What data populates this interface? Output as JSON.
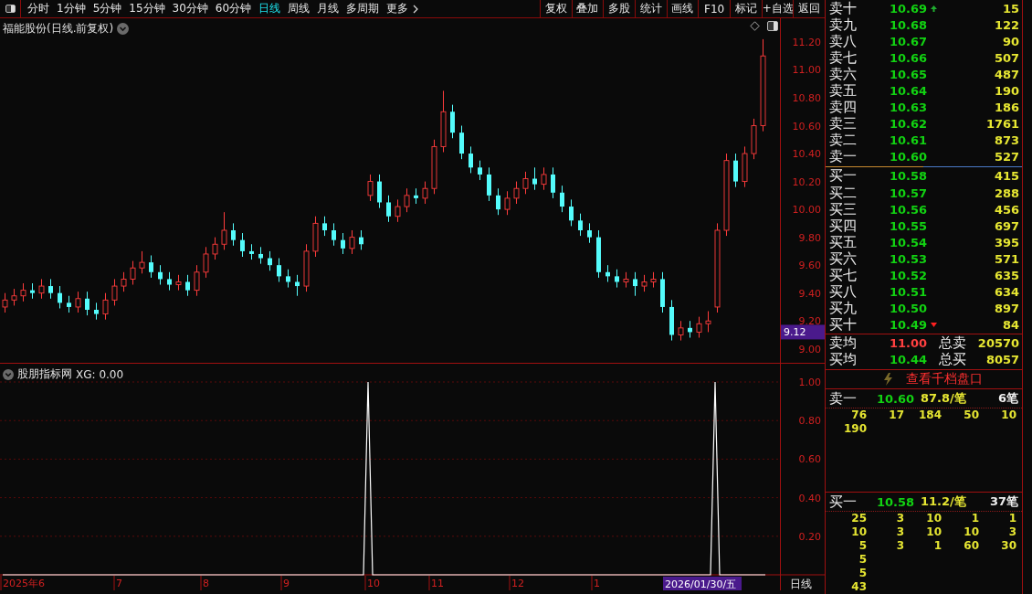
{
  "toolbar": {
    "periods": [
      {
        "label": "分时",
        "selected": false
      },
      {
        "label": "1分钟",
        "selected": false
      },
      {
        "label": "5分钟",
        "selected": false
      },
      {
        "label": "15分钟",
        "selected": false
      },
      {
        "label": "30分钟",
        "selected": false
      },
      {
        "label": "60分钟",
        "selected": false
      },
      {
        "label": "日线",
        "selected": true
      },
      {
        "label": "周线",
        "selected": false
      },
      {
        "label": "月线",
        "selected": false
      },
      {
        "label": "多周期",
        "selected": false
      },
      {
        "label": "更多",
        "selected": false
      }
    ],
    "buttons": [
      "复权",
      "叠加",
      "多股",
      "统计",
      "画线",
      "F10",
      "标记",
      "+自选",
      "返回"
    ]
  },
  "price_chart": {
    "title": "福能股份(日线.前复权)",
    "cursor_price": "9.12",
    "chart_data": {
      "type": "candlestick",
      "ylim": [
        8.9,
        11.37
      ],
      "yticks": [
        {
          "value": 11.2,
          "label": "11.20"
        },
        {
          "value": 11.0,
          "label": "11.00"
        },
        {
          "value": 10.8,
          "label": "10.80"
        },
        {
          "value": 10.6,
          "label": "10.60"
        },
        {
          "value": 10.4,
          "label": "10.40"
        },
        {
          "value": 10.2,
          "label": "10.20"
        },
        {
          "value": 10.0,
          "label": "10.00"
        },
        {
          "value": 9.8,
          "label": "9.80"
        },
        {
          "value": 9.6,
          "label": "9.60"
        },
        {
          "value": 9.4,
          "label": "9.40"
        },
        {
          "value": 9.2,
          "label": "9.20"
        },
        {
          "value": 9.0,
          "label": "9.00"
        }
      ],
      "ohlc": [
        [
          9.3,
          9.4,
          9.26,
          9.35
        ],
        [
          9.35,
          9.43,
          9.31,
          9.38
        ],
        [
          9.38,
          9.47,
          9.34,
          9.42
        ],
        [
          9.42,
          9.47,
          9.36,
          9.4
        ],
        [
          9.4,
          9.5,
          9.36,
          9.45
        ],
        [
          9.45,
          9.5,
          9.36,
          9.4
        ],
        [
          9.4,
          9.45,
          9.29,
          9.33
        ],
        [
          9.33,
          9.38,
          9.26,
          9.3
        ],
        [
          9.3,
          9.41,
          9.26,
          9.36
        ],
        [
          9.36,
          9.41,
          9.24,
          9.28
        ],
        [
          9.28,
          9.33,
          9.21,
          9.25
        ],
        [
          9.25,
          9.4,
          9.21,
          9.35
        ],
        [
          9.35,
          9.5,
          9.31,
          9.45
        ],
        [
          9.45,
          9.55,
          9.41,
          9.5
        ],
        [
          9.5,
          9.63,
          9.46,
          9.58
        ],
        [
          9.58,
          9.7,
          9.54,
          9.62
        ],
        [
          9.62,
          9.67,
          9.51,
          9.55
        ],
        [
          9.55,
          9.6,
          9.46,
          9.5
        ],
        [
          9.5,
          9.55,
          9.42,
          9.46
        ],
        [
          9.46,
          9.53,
          9.42,
          9.48
        ],
        [
          9.48,
          9.53,
          9.38,
          9.42
        ],
        [
          9.42,
          9.6,
          9.38,
          9.55
        ],
        [
          9.55,
          9.73,
          9.51,
          9.68
        ],
        [
          9.68,
          9.8,
          9.64,
          9.75
        ],
        [
          9.75,
          9.98,
          9.71,
          9.85
        ],
        [
          9.85,
          9.9,
          9.74,
          9.78
        ],
        [
          9.78,
          9.83,
          9.66,
          9.7
        ],
        [
          9.7,
          9.75,
          9.64,
          9.68
        ],
        [
          9.68,
          9.73,
          9.61,
          9.65
        ],
        [
          9.65,
          9.7,
          9.56,
          9.6
        ],
        [
          9.6,
          9.65,
          9.48,
          9.52
        ],
        [
          9.52,
          9.57,
          9.44,
          9.48
        ],
        [
          9.48,
          9.53,
          9.38,
          9.45
        ],
        [
          9.45,
          9.75,
          9.41,
          9.7
        ],
        [
          9.7,
          9.95,
          9.66,
          9.9
        ],
        [
          9.9,
          9.95,
          9.81,
          9.85
        ],
        [
          9.85,
          9.9,
          9.74,
          9.78
        ],
        [
          9.78,
          9.83,
          9.68,
          9.72
        ],
        [
          9.72,
          9.85,
          9.68,
          9.8
        ],
        [
          9.8,
          9.85,
          9.71,
          9.75
        ],
        [
          10.1,
          10.25,
          10.06,
          10.2
        ],
        [
          10.2,
          10.25,
          10.01,
          10.05
        ],
        [
          10.05,
          10.1,
          9.91,
          9.95
        ],
        [
          9.95,
          10.07,
          9.91,
          10.02
        ],
        [
          10.02,
          10.15,
          9.98,
          10.1
        ],
        [
          10.1,
          10.15,
          10.04,
          10.08
        ],
        [
          10.08,
          10.2,
          10.04,
          10.15
        ],
        [
          10.15,
          10.5,
          10.11,
          10.45
        ],
        [
          10.45,
          10.85,
          10.41,
          10.7
        ],
        [
          10.7,
          10.75,
          10.51,
          10.55
        ],
        [
          10.55,
          10.6,
          10.36,
          10.4
        ],
        [
          10.4,
          10.45,
          10.26,
          10.3
        ],
        [
          10.3,
          10.35,
          10.21,
          10.25
        ],
        [
          10.25,
          10.3,
          10.06,
          10.1
        ],
        [
          10.1,
          10.15,
          9.96,
          10.0
        ],
        [
          10.0,
          10.13,
          9.96,
          10.08
        ],
        [
          10.08,
          10.2,
          10.04,
          10.15
        ],
        [
          10.15,
          10.27,
          10.11,
          10.22
        ],
        [
          10.22,
          10.3,
          10.14,
          10.18
        ],
        [
          10.18,
          10.3,
          10.14,
          10.25
        ],
        [
          10.25,
          10.3,
          10.08,
          10.12
        ],
        [
          10.12,
          10.17,
          9.98,
          10.02
        ],
        [
          10.02,
          10.07,
          9.88,
          9.92
        ],
        [
          9.92,
          9.97,
          9.81,
          9.85
        ],
        [
          9.85,
          9.9,
          9.76,
          9.8
        ],
        [
          9.8,
          9.85,
          9.51,
          9.55
        ],
        [
          9.55,
          9.6,
          9.48,
          9.52
        ],
        [
          9.52,
          9.57,
          9.44,
          9.48
        ],
        [
          9.48,
          9.55,
          9.44,
          9.5
        ],
        [
          9.5,
          9.55,
          9.38,
          9.45
        ],
        [
          9.45,
          9.53,
          9.41,
          9.48
        ],
        [
          9.48,
          9.55,
          9.44,
          9.5
        ],
        [
          9.5,
          9.55,
          9.26,
          9.3
        ],
        [
          9.3,
          9.35,
          9.06,
          9.1
        ],
        [
          9.1,
          9.2,
          9.06,
          9.15
        ],
        [
          9.15,
          9.2,
          9.08,
          9.12
        ],
        [
          9.12,
          9.23,
          9.08,
          9.18
        ],
        [
          9.18,
          9.27,
          9.12,
          9.2
        ],
        [
          9.3,
          9.9,
          9.26,
          9.85
        ],
        [
          9.85,
          10.4,
          9.81,
          10.35
        ],
        [
          10.35,
          10.4,
          10.16,
          10.2
        ],
        [
          10.2,
          10.45,
          10.16,
          10.4
        ],
        [
          10.4,
          10.65,
          10.36,
          10.6
        ],
        [
          10.6,
          11.22,
          10.56,
          11.1
        ]
      ]
    }
  },
  "indicator": {
    "title": "股朋指标网",
    "reading": ": 0.00",
    "chart_data": {
      "type": "line",
      "ylim": [
        0,
        1
      ],
      "grid": true,
      "yticks": [
        {
          "value": 1,
          "label": "1.00"
        },
        {
          "value": 0.8,
          "label": "0.80"
        },
        {
          "value": 0.6,
          "label": "0.60"
        },
        {
          "value": 0.4,
          "label": "0.40"
        },
        {
          "value": 0.2,
          "label": "0.20"
        }
      ],
      "series": [
        {
          "name": "XG",
          "color": "#ffffff",
          "values": [
            0,
            0,
            0,
            0,
            0,
            0,
            0,
            0,
            0,
            0,
            0,
            0,
            0,
            0,
            0,
            0,
            0,
            0,
            0,
            0,
            0,
            0,
            0,
            0,
            0,
            0,
            0,
            0,
            0,
            0,
            0,
            0,
            0,
            0,
            0,
            0,
            0,
            0,
            0,
            0,
            0,
            0,
            0,
            0,
            0,
            0,
            0,
            0,
            0,
            0,
            0,
            0,
            0,
            0,
            0,
            0,
            0,
            0,
            0,
            0,
            0,
            0,
            0,
            0,
            0,
            0,
            0,
            0,
            0,
            0,
            0,
            0,
            0,
            0,
            0,
            0,
            0,
            0,
            0,
            0,
            1,
            0,
            0,
            0,
            0,
            0,
            0,
            0,
            0,
            0,
            0,
            0,
            0,
            0,
            0,
            0,
            0,
            0,
            0,
            0,
            0,
            0,
            0,
            0,
            0,
            0,
            0,
            0,
            0,
            0,
            0,
            0,
            0,
            0,
            0,
            0,
            0,
            0,
            0,
            0,
            0,
            0,
            0,
            0,
            0,
            0,
            0,
            0,
            0,
            0,
            0,
            0,
            0,
            0,
            0,
            0,
            0,
            0,
            0,
            0,
            0,
            0,
            0,
            0,
            0,
            0,
            0,
            0,
            0,
            0,
            0,
            0,
            0,
            0,
            0,
            0,
            1,
            0,
            0,
            0,
            0,
            0,
            0,
            0,
            0,
            0,
            0,
            0
          ]
        }
      ]
    }
  },
  "time_axis": {
    "labels": [
      "2025年6",
      "7",
      "8",
      "9",
      "10",
      "11",
      "12",
      "1"
    ],
    "cursor_date": "2026/01/30/五",
    "period": "日线"
  },
  "order_book": {
    "asks": [
      {
        "label": "卖十",
        "price": "10.69",
        "volume": "15",
        "kind": "up"
      },
      {
        "label": "卖九",
        "price": "10.68",
        "volume": "122",
        "kind": "plain"
      },
      {
        "label": "卖八",
        "price": "10.67",
        "volume": "90",
        "kind": "plain"
      },
      {
        "label": "卖七",
        "price": "10.66",
        "volume": "507",
        "kind": "plain"
      },
      {
        "label": "卖六",
        "price": "10.65",
        "volume": "487",
        "kind": "plain"
      },
      {
        "label": "卖五",
        "price": "10.64",
        "volume": "190",
        "kind": "plain"
      },
      {
        "label": "卖四",
        "price": "10.63",
        "volume": "186",
        "kind": "plain"
      },
      {
        "label": "卖三",
        "price": "10.62",
        "volume": "1761",
        "kind": "plain"
      },
      {
        "label": "卖二",
        "price": "10.61",
        "volume": "873",
        "kind": "plain"
      },
      {
        "label": "卖一",
        "price": "10.60",
        "volume": "527",
        "kind": "plain"
      }
    ],
    "bids": [
      {
        "label": "买一",
        "price": "10.58",
        "volume": "415",
        "kind": "plain"
      },
      {
        "label": "买二",
        "price": "10.57",
        "volume": "288",
        "kind": "plain"
      },
      {
        "label": "买三",
        "price": "10.56",
        "volume": "456",
        "kind": "plain"
      },
      {
        "label": "买四",
        "price": "10.55",
        "volume": "697",
        "kind": "plain"
      },
      {
        "label": "买五",
        "price": "10.54",
        "volume": "395",
        "kind": "plain"
      },
      {
        "label": "买六",
        "price": "10.53",
        "volume": "571",
        "kind": "plain"
      },
      {
        "label": "买七",
        "price": "10.52",
        "volume": "635",
        "kind": "plain"
      },
      {
        "label": "买八",
        "price": "10.51",
        "volume": "634",
        "kind": "plain"
      },
      {
        "label": "买九",
        "price": "10.50",
        "volume": "897",
        "kind": "plain"
      },
      {
        "label": "买十",
        "price": "10.49",
        "volume": "84",
        "kind": "down"
      }
    ],
    "summary": [
      {
        "label": "卖均",
        "price": "11.00",
        "rising": true,
        "total_label": "总卖",
        "total": "20570"
      },
      {
        "label": "买均",
        "price": "10.44",
        "rising": false,
        "total_label": "总买",
        "total": "8057"
      }
    ],
    "depth_link": "查看千档盘口",
    "queues": [
      {
        "label": "卖一",
        "price": "10.60",
        "avg": "87.8/笔",
        "count": "6笔",
        "orders": [
          [
            "76",
            "17",
            "184",
            "50",
            "10"
          ],
          [
            "190"
          ]
        ]
      },
      {
        "label": "买一",
        "price": "10.58",
        "avg": "11.2/笔",
        "count": "37笔",
        "orders": [
          [
            "25",
            "3",
            "10",
            "1",
            "1"
          ],
          [
            "10",
            "3",
            "10",
            "10",
            "3"
          ],
          [
            "5",
            "3",
            "1",
            "60",
            "30"
          ],
          [
            "5"
          ],
          [
            "5"
          ],
          [
            "43"
          ]
        ]
      }
    ]
  }
}
